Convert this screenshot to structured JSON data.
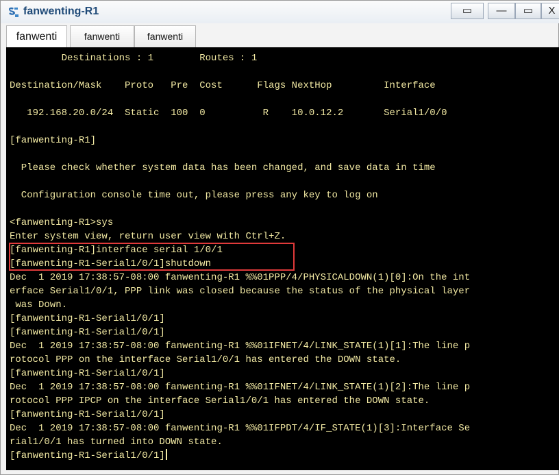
{
  "window": {
    "title": "fanwenting-R1",
    "controls": {
      "restore": "▭",
      "minimize": "—",
      "maximize": "▭",
      "close": "X"
    }
  },
  "tabs": [
    {
      "label": "fanwenti"
    },
    {
      "label": "fanwenti"
    },
    {
      "label": "fanwenti"
    }
  ],
  "terminal": {
    "lines": [
      "         Destinations : 1        Routes : 1",
      "",
      "Destination/Mask    Proto   Pre  Cost      Flags NextHop         Interface",
      "",
      "   192.168.20.0/24  Static  100  0          R    10.0.12.2       Serial1/0/0",
      "",
      "[fanwenting-R1]",
      "",
      "  Please check whether system data has been changed, and save data in time",
      "",
      "  Configuration console time out, please press any key to log on",
      "",
      "<fanwenting-R1>sys",
      "Enter system view, return user view with Ctrl+Z.",
      "[fanwenting-R1]interface serial 1/0/1",
      "[fanwenting-R1-Serial1/0/1]shutdown",
      "Dec  1 2019 17:38:57-08:00 fanwenting-R1 %%01PPP/4/PHYSICALDOWN(1)[0]:On the int",
      "erface Serial1/0/1, PPP link was closed because the status of the physical layer",
      " was Down.",
      "[fanwenting-R1-Serial1/0/1]",
      "[fanwenting-R1-Serial1/0/1]",
      "Dec  1 2019 17:38:57-08:00 fanwenting-R1 %%01IFNET/4/LINK_STATE(1)[1]:The line p",
      "rotocol PPP on the interface Serial1/0/1 has entered the DOWN state.",
      "[fanwenting-R1-Serial1/0/1]",
      "Dec  1 2019 17:38:57-08:00 fanwenting-R1 %%01IFNET/4/LINK_STATE(1)[2]:The line p",
      "rotocol PPP IPCP on the interface Serial1/0/1 has entered the DOWN state.",
      "[fanwenting-R1-Serial1/0/1]",
      "Dec  1 2019 17:38:57-08:00 fanwenting-R1 %%01IFPDT/4/IF_STATE(1)[3]:Interface Se",
      "rial1/0/1 has turned into DOWN state.",
      "[fanwenting-R1-Serial1/0/1]"
    ]
  },
  "colors": {
    "terminal_bg": "#000000",
    "terminal_text": "#f2e9a3",
    "highlight_border": "#e03a3a",
    "title_text": "#1f4a78"
  }
}
